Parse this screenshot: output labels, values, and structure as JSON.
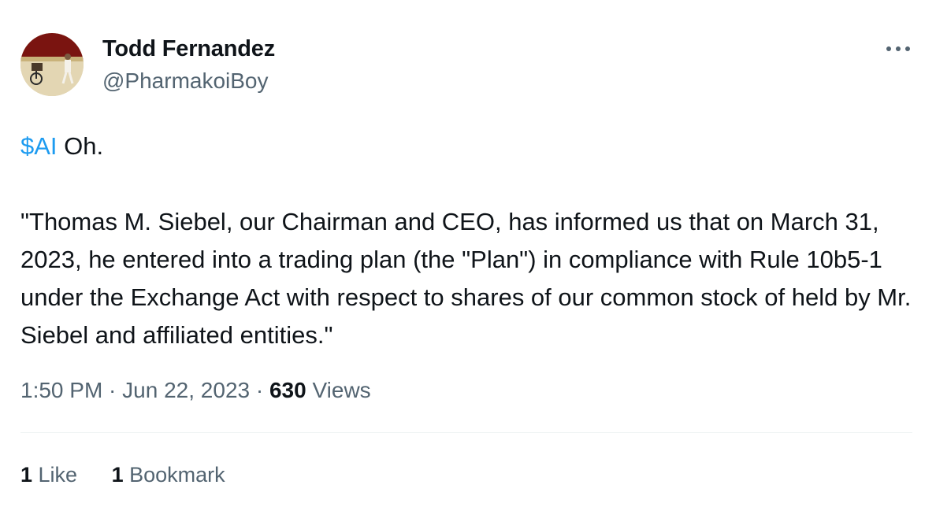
{
  "author": {
    "display_name": "Todd Fernandez",
    "handle": "@PharmakoiBoy",
    "avatar_icon": "profile-photo"
  },
  "more_icon": "more-horizontal-icon",
  "tweet": {
    "cashtag": "$AI",
    "lead_text": " Oh.",
    "quote": "\"Thomas M. Siebel, our Chairman and CEO, has informed us that on March 31, 2023, he entered into a trading plan (the \"Plan\") in compliance with Rule 10b5-1 under the Exchange Act with respect to shares of our common stock of held by Mr. Siebel and affiliated entities.\""
  },
  "meta": {
    "time": "1:50 PM",
    "separator": " · ",
    "date": "Jun 22, 2023",
    "views_count": "630",
    "views_label": " Views"
  },
  "stats": {
    "likes_count": "1",
    "likes_label": " Like",
    "bookmarks_count": "1",
    "bookmarks_label": " Bookmark"
  },
  "colors": {
    "accent": "#1d9bf0",
    "text": "#0f1419",
    "secondary": "#536471",
    "divider": "#eff3f4"
  }
}
